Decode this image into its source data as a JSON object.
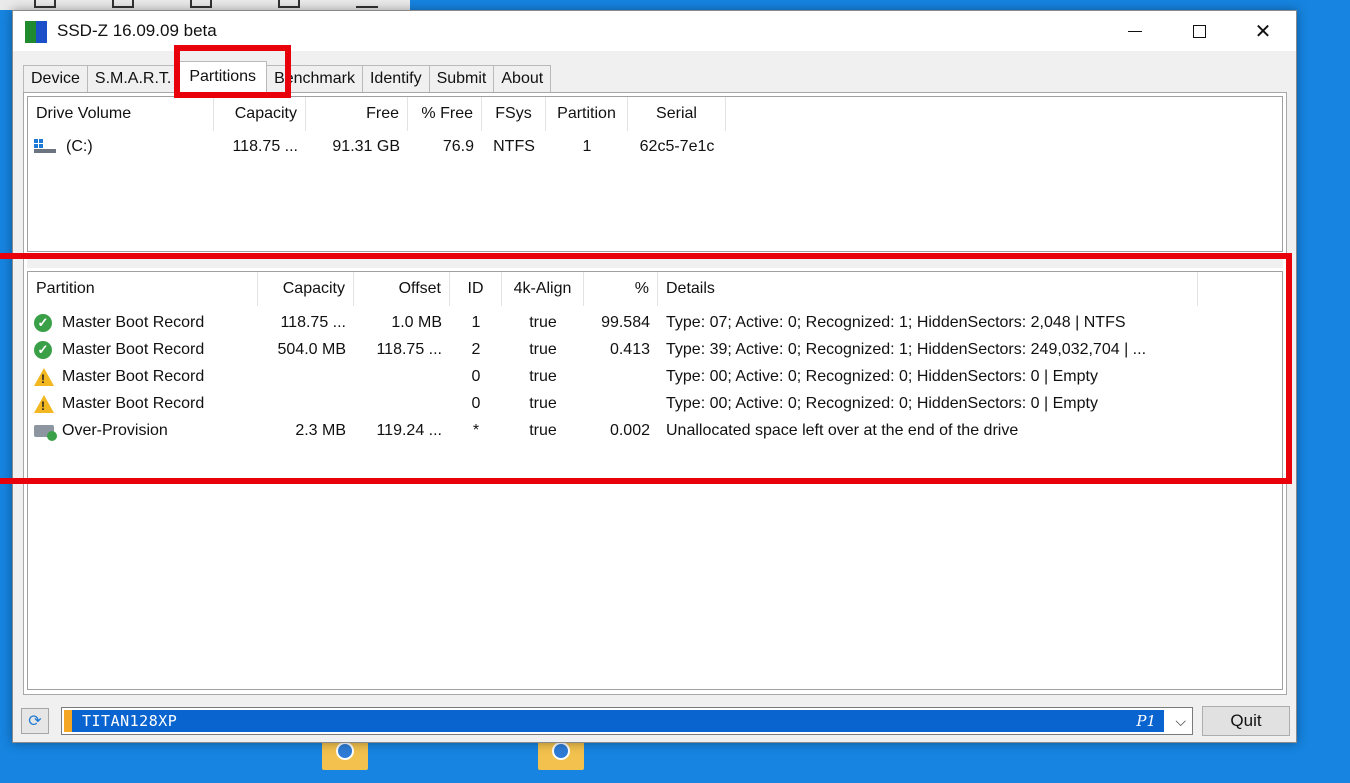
{
  "window": {
    "title": "SSD-Z 16.09.09 beta"
  },
  "tabs": [
    {
      "label": "Device"
    },
    {
      "label": "S.M.A.R.T."
    },
    {
      "label": "Partitions",
      "active": true
    },
    {
      "label": "Benchmark"
    },
    {
      "label": "Identify"
    },
    {
      "label": "Submit"
    },
    {
      "label": "About"
    }
  ],
  "volumes": {
    "headers": {
      "drive_volume": "Drive Volume",
      "capacity": "Capacity",
      "free": "Free",
      "pct_free": "% Free",
      "fsys": "FSys",
      "partition": "Partition",
      "serial": "Serial"
    },
    "rows": [
      {
        "icon": "drive-volume-icon",
        "drive_volume": "(C:)",
        "capacity": "118.75 ...",
        "free": "91.31 GB",
        "pct_free": "76.9",
        "fsys": "NTFS",
        "partition": "1",
        "serial": "62c5-7e1c"
      }
    ]
  },
  "partitions": {
    "headers": {
      "partition": "Partition",
      "capacity": "Capacity",
      "offset": "Offset",
      "id": "ID",
      "align": "4k-Align",
      "pct": "%",
      "details": "Details"
    },
    "rows": [
      {
        "icon": "ok-check-icon",
        "partition": "Master Boot Record",
        "capacity": "118.75 ...",
        "offset": "1.0 MB",
        "id": "1",
        "align": "true",
        "pct": "99.584",
        "details": "Type: 07; Active: 0; Recognized: 1; HiddenSectors: 2,048 | NTFS"
      },
      {
        "icon": "ok-check-icon",
        "partition": "Master Boot Record",
        "capacity": "504.0 MB",
        "offset": "118.75 ...",
        "id": "2",
        "align": "true",
        "pct": "0.413",
        "details": "Type: 39; Active: 0; Recognized: 1; HiddenSectors: 249,032,704 | ..."
      },
      {
        "icon": "warning-icon",
        "partition": "Master Boot Record",
        "capacity": "",
        "offset": "",
        "id": "0",
        "align": "true",
        "pct": "",
        "details": "Type: 00; Active: 0; Recognized: 0; HiddenSectors: 0 | Empty"
      },
      {
        "icon": "warning-icon",
        "partition": "Master Boot Record",
        "capacity": "",
        "offset": "",
        "id": "0",
        "align": "true",
        "pct": "",
        "details": "Type: 00; Active: 0; Recognized: 0; HiddenSectors: 0 | Empty"
      },
      {
        "icon": "drive-add-icon",
        "partition": "Over-Provision",
        "capacity": "2.3 MB",
        "offset": "119.24 ...",
        "id": "*",
        "align": "true",
        "pct": "0.002",
        "details": "Unallocated space left over at the end of the drive"
      }
    ]
  },
  "drive_select": {
    "value": "TITAN128XP",
    "suffix": "P1"
  },
  "buttons": {
    "quit": "Quit"
  },
  "colors": {
    "desktop": "#1684e0",
    "selection": "#0a64d0",
    "highlight": "#e8000b",
    "ok": "#3aa047",
    "warning": "#f3b721"
  }
}
